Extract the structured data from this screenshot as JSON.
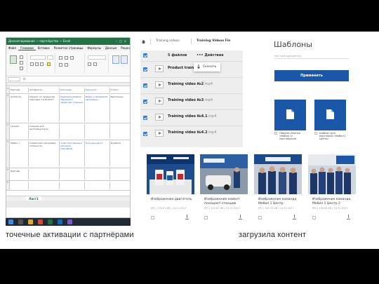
{
  "excel": {
    "title": "Дисконтирование — партнёрство — Excel",
    "ribbon_tabs": [
      "Файл",
      "Главная",
      "Вставка",
      "Разметка страницы",
      "Формулы",
      "Данные",
      "Рецензирование",
      "Вид",
      "Разработчик"
    ],
    "active_tab_index": 1,
    "sheet_tab": "Лист1",
    "rows": [
      {
        "num": "1",
        "cells": [
          "Партнёр",
          "Активность",
          "Описание",
          "Результат",
          "Статус"
        ]
      },
      {
        "num": "2",
        "cells": [
          "Audi/Coca",
          "Тренинг по продуктам партнёра, 12.06.2017",
          "Компания провела обучение в сервисных станциях",
          "Видео и материалы загружены",
          "Выполнено"
        ]
      },
      {
        "num": "3",
        "cells": [
          "Генезис",
          "Семинар для дистрибьюторов",
          "",
          "",
          ""
        ]
      },
      {
        "num": "4",
        "cells": [
          "Мобил 1",
          "Совместная программа лояльности",
          "Старт программы и рассылка партнёрам",
          "Получены фото",
          "В работе"
        ]
      },
      {
        "num": "5",
        "cells": [
          "Партнёр",
          "",
          "",
          "",
          ""
        ]
      },
      {
        "num": "6",
        "cells": [
          "",
          "",
          "",
          "",
          ""
        ]
      }
    ],
    "colors": {
      "header": "#217346"
    }
  },
  "left_caption": "точечные активации с партнёрами",
  "right_caption": "загрузила контент",
  "files": {
    "breadcrumbs": [
      "Training videos",
      "Training Videos Fin"
    ],
    "count_label": "5 файлов",
    "actions_label": "Действия",
    "dropdown_item": "Скачать",
    "rows": [
      {
        "name": "Product training N",
        "ext": ""
      },
      {
        "name": "Training video №2",
        "ext": ".mp4"
      },
      {
        "name": "Training video №3",
        "ext": ".mp4"
      },
      {
        "name": "Training video №4.1",
        "ext": ".mp4"
      },
      {
        "name": "Training video №4.2",
        "ext": ".mp4"
      }
    ],
    "footer": "5 файлов",
    "accent": "#2f7fd6"
  },
  "templates": {
    "title": "Шаблоны",
    "search_placeholder": "Нет типа документа",
    "apply_button": "Применить",
    "cards": [
      {
        "caption": "Образец бланка «Мобил 1» партнёрский"
      },
      {
        "caption": "Шаблон для партнёров «Мобил 1 Центр»"
      }
    ],
    "accent": "#1a57a8"
  },
  "gallery": [
    {
      "title": "Изображение двигатель",
      "meta": "JPG | 159.91 KB | 14.12.2017"
    },
    {
      "title": "Изображение клиент посещает станцию",
      "meta": "JPG | 102.67 KB | 14.12.2017"
    },
    {
      "title": "Изображение команда Мобил 1 Центр",
      "meta": "JPG | 167.43 KB | 14.12.2017"
    },
    {
      "title": "Изображение команда Мобил 1 Центр 2",
      "meta": "JPG | 156.08 KB | 14.12.2017"
    }
  ]
}
